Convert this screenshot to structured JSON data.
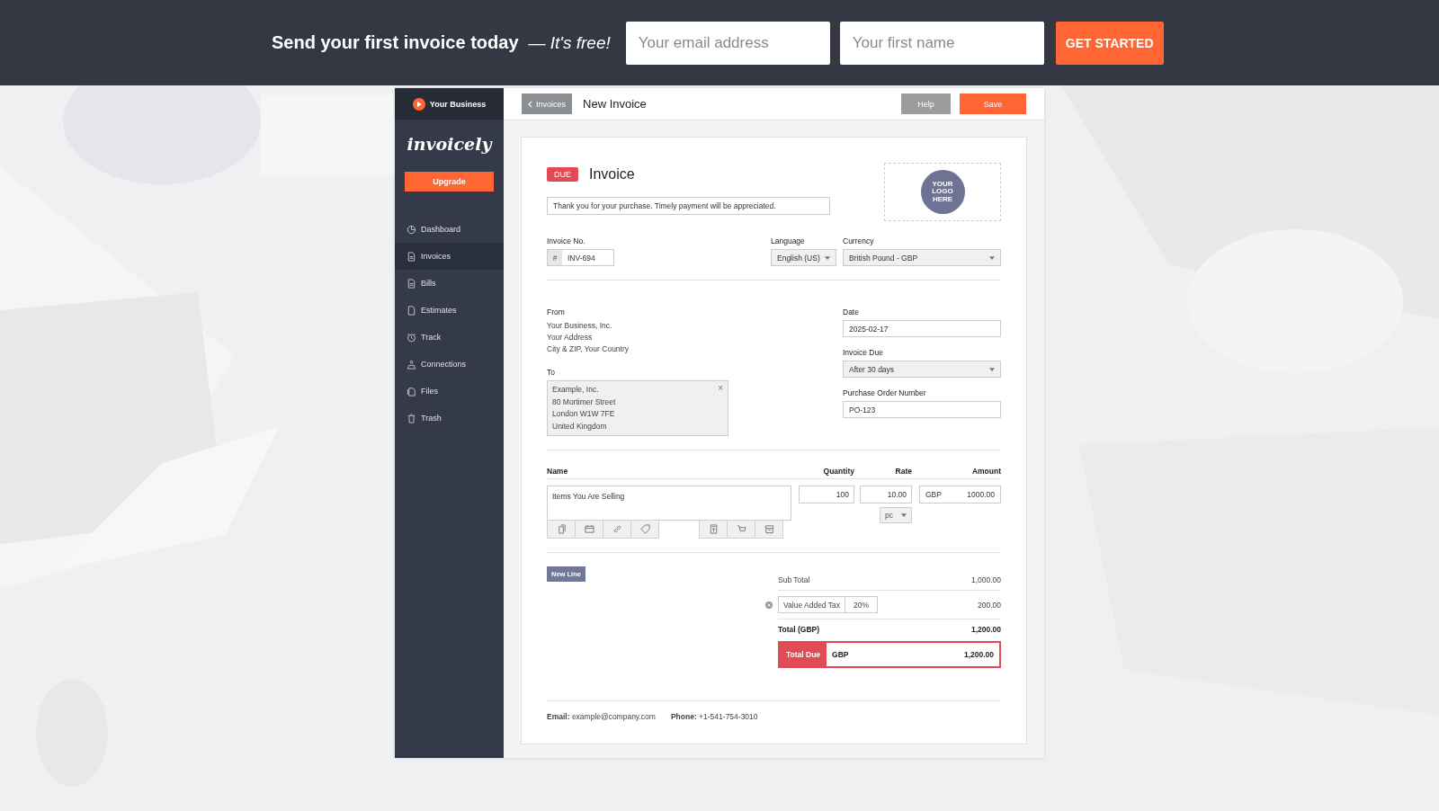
{
  "promo": {
    "headline": "Send your first invoice today",
    "tagline": "— It's free!",
    "email": {
      "placeholder": "Your email address"
    },
    "first_name": {
      "placeholder": "Your first name"
    },
    "button": "GET STARTED"
  },
  "sidebar": {
    "business": "Your Business",
    "logo": "invoicely",
    "upgrade": "Upgrade",
    "items": [
      {
        "label": "Dashboard",
        "kind": "dashboard",
        "selected": false
      },
      {
        "label": "Invoices",
        "kind": "invoice",
        "selected": true
      },
      {
        "label": "Bills",
        "kind": "bill",
        "selected": false
      },
      {
        "label": "Estimates",
        "kind": "estimate",
        "selected": false
      },
      {
        "label": "Track",
        "kind": "track",
        "selected": false
      },
      {
        "label": "Connections",
        "kind": "connections",
        "selected": false
      },
      {
        "label": "Files",
        "kind": "files",
        "selected": false
      },
      {
        "label": "Trash",
        "kind": "trash",
        "selected": false
      }
    ]
  },
  "header": {
    "back": "Invoices",
    "title": "New Invoice",
    "buttons": [
      {
        "label": "Help",
        "disabled": true
      },
      {
        "label": "Save",
        "disabled": false
      }
    ]
  },
  "invoice": {
    "status": "DUE",
    "title": "Invoice",
    "note": "Thank you for your purchase. Timely payment will be appreciated.",
    "logo": [
      "YOUR",
      "LOGO",
      "HERE"
    ],
    "invoice_no": {
      "label": "Invoice No.",
      "prefix": "#",
      "value": "INV-694"
    },
    "language": {
      "label": "Language",
      "value": "English (US)"
    },
    "currency": {
      "label": "Currency",
      "value": "British Pound - GBP"
    },
    "from": {
      "label": "From",
      "lines": [
        "Your Business, Inc.",
        "Your Address",
        "City & ZIP, Your Country"
      ]
    },
    "to": {
      "label": "To",
      "lines": [
        "Example, Inc.",
        "80 Mortimer Street",
        "London W1W 7FE",
        "United Kingdom"
      ],
      "clear": "×"
    },
    "date": {
      "label": "Date",
      "value": "2025-02-17"
    },
    "due": {
      "label": "Invoice Due",
      "value": "After 30 days"
    },
    "po": {
      "label": "Purchase Order Number",
      "value": "PO-123"
    },
    "columns": [
      "Name",
      "Quantity",
      "Rate",
      "Amount"
    ],
    "rows": [
      {
        "name": "Items You Are Selling",
        "quantity": "100",
        "rate": "10.00",
        "unit": "pc",
        "currency": "GBP",
        "amount": "1000.00"
      }
    ],
    "new_line": "New Line",
    "subtotal": {
      "label": "Sub Total",
      "value": "1,000.00"
    },
    "tax": {
      "name": "Value Added Tax",
      "rate": "20%",
      "amount": "200.00"
    },
    "total": {
      "label": "Total (GBP)",
      "value": "1,200.00"
    },
    "total_due": {
      "label": "Total Due",
      "currency": "GBP",
      "value": "1,200.00"
    },
    "footer": [
      "**Email:** example@company.com",
      "**Phone:** +1-541-754-3010"
    ]
  }
}
